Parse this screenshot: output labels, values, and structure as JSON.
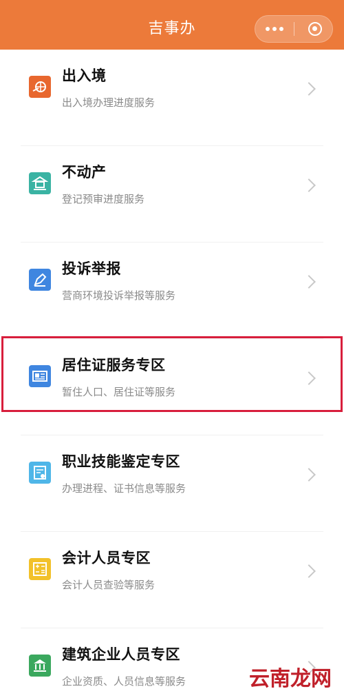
{
  "header": {
    "title": "吉事办",
    "more_icon": "more-dots-icon",
    "close_icon": "target-close-icon",
    "background": "#ec7a3a"
  },
  "items": [
    {
      "title": "出入境",
      "subtitle": "出入境办理进度服务",
      "icon": "passport-icon",
      "icon_color": "#e8672e"
    },
    {
      "title": "不动产",
      "subtitle": "登记预审进度服务",
      "icon": "building-icon",
      "icon_color": "#3ab3a3"
    },
    {
      "title": "投诉举报",
      "subtitle": "营商环境投诉举报等服务",
      "icon": "pen-icon",
      "icon_color": "#3f86e0"
    },
    {
      "title": "居住证服务专区",
      "subtitle": "暂住人口、居住证等服务",
      "icon": "id-card-icon",
      "icon_color": "#3f86e0"
    },
    {
      "title": "职业技能鉴定专区",
      "subtitle": "办理进程、证书信息等服务",
      "icon": "certificate-icon",
      "icon_color": "#4fb6e8"
    },
    {
      "title": "会计人员专区",
      "subtitle": "会计人员查验等服务",
      "icon": "calculator-icon",
      "icon_color": "#f2c12a"
    },
    {
      "title": "建筑企业人员专区",
      "subtitle": "企业资质、人员信息等服务",
      "icon": "bank-icon",
      "icon_color": "#3ba85e"
    }
  ],
  "highlight_color": "#d81e3c",
  "watermark": "云南龙网"
}
